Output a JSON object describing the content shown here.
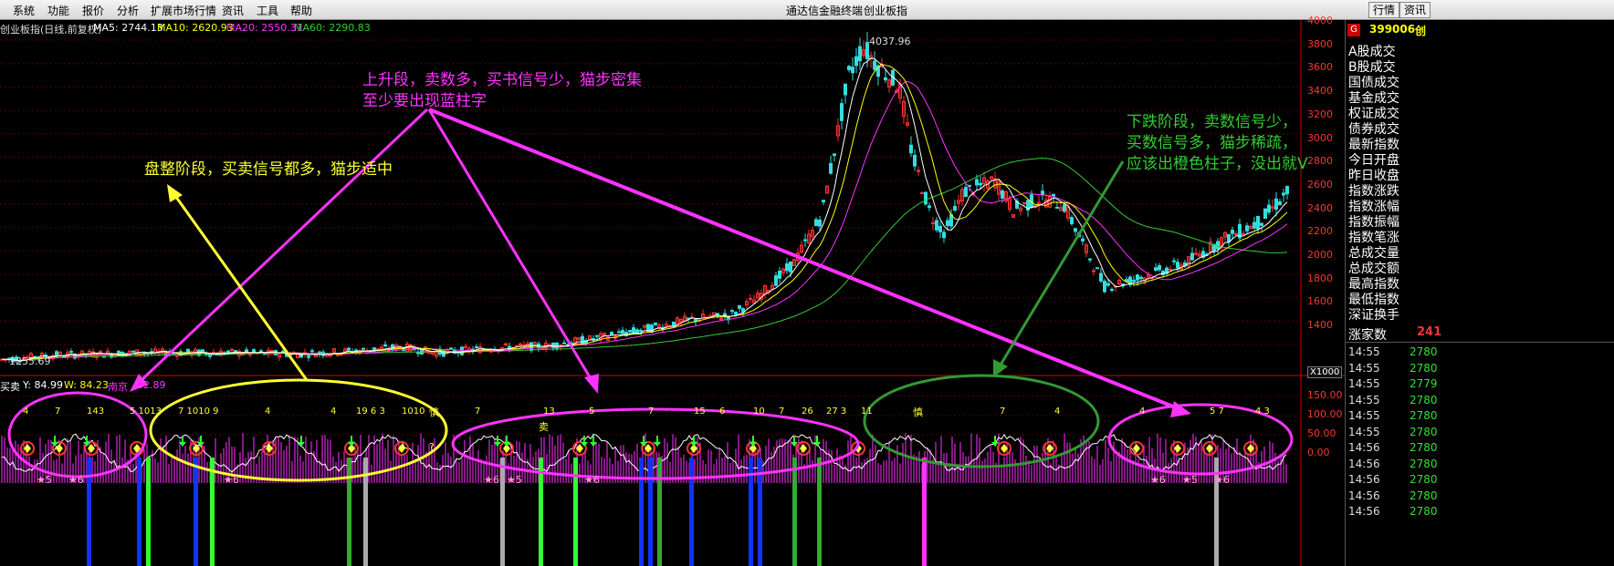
{
  "menu": {
    "items": [
      "系统",
      "功能",
      "报价",
      "分析",
      "扩展市场行情",
      "资讯",
      "工具",
      "帮助"
    ],
    "app_title": "通达信金融终端",
    "index_name": "创业板指",
    "right_buttons": [
      "行情",
      "资讯"
    ]
  },
  "chart_info": {
    "name": "创业板指(日线,前复权)",
    "ma5": "MA5: 2744.13",
    "ma10": "MA10: 2620.93",
    "ma20": "MA20: 2550.31",
    "ma60": "MA60: 2290.83",
    "high_label": "4037.96",
    "low_label": "1255.69",
    "colors": {
      "ma5": "#ffffff",
      "ma10": "#ffff00",
      "ma20": "#ff33ff",
      "ma60": "#33cc33"
    }
  },
  "price_axis": [
    "4000",
    "3800",
    "3600",
    "3400",
    "3200",
    "3000",
    "2800",
    "2600",
    "2400",
    "2200",
    "2000",
    "1800",
    "1600",
    "1400"
  ],
  "x_scale": "X1000",
  "indicator": {
    "title_prefix": "买卖",
    "y": "Y: 84.99",
    "w": "W: 84.23",
    "nanjing": "南京",
    "nanjing_val": "82.89",
    "axis": [
      "150.00",
      "100.00",
      "50.00",
      "0.00"
    ]
  },
  "annotations": {
    "up_line1": "上升段，卖数多，买书信号少，猫步密集",
    "up_line2": "至少要出现蓝柱字",
    "consolidation": "盘整阶段，买卖信号都多，猫步适中",
    "down_line1": "下跌阶段，卖数信号少，",
    "down_line2": "买数信号多，猫步稀疏，",
    "down_line3": "应该出橙色柱子，没出就V"
  },
  "side": {
    "code": "399006",
    "code_suffix": "创",
    "items": [
      "A股成交",
      "B股成交",
      "国债成交",
      "基金成交",
      "权证成交",
      "债券成交",
      "最新指数",
      "今日开盘",
      "昨日收盘",
      "指数涨跌",
      "指数涨幅",
      "指数振幅",
      "指数笔涨",
      "总成交量",
      "总成交额",
      "最高指数",
      "最低指数",
      "深证换手"
    ],
    "rising_label": "涨家数",
    "rising_value": "241",
    "ticks": [
      {
        "time": "14:55",
        "val": "2780"
      },
      {
        "time": "14:55",
        "val": "2780"
      },
      {
        "time": "14:55",
        "val": "2779"
      },
      {
        "time": "14:55",
        "val": "2780"
      },
      {
        "time": "14:55",
        "val": "2780"
      },
      {
        "time": "14:55",
        "val": "2780"
      },
      {
        "time": "14:56",
        "val": "2780"
      },
      {
        "time": "14:56",
        "val": "2780"
      },
      {
        "time": "14:56",
        "val": "2780"
      },
      {
        "time": "14:56",
        "val": "2780"
      },
      {
        "time": "14:56",
        "val": "2780"
      }
    ]
  },
  "signal_labels": {
    "top_numbers": [
      "4",
      "7",
      "143",
      "5 1013",
      "7 1010 9",
      "4",
      "4",
      "19 6 3",
      "1010",
      "7",
      "13",
      "5",
      "7",
      "15",
      "6",
      "10",
      "7",
      "26",
      "27 3",
      "11",
      "7",
      "4",
      "4",
      "5 7",
      "4 3"
    ],
    "sell": "卖",
    "caution": "慎",
    "question": "?",
    "star_labels": [
      "5",
      "6",
      "6",
      "6",
      "5",
      "6",
      "6",
      "5",
      "6"
    ]
  }
}
